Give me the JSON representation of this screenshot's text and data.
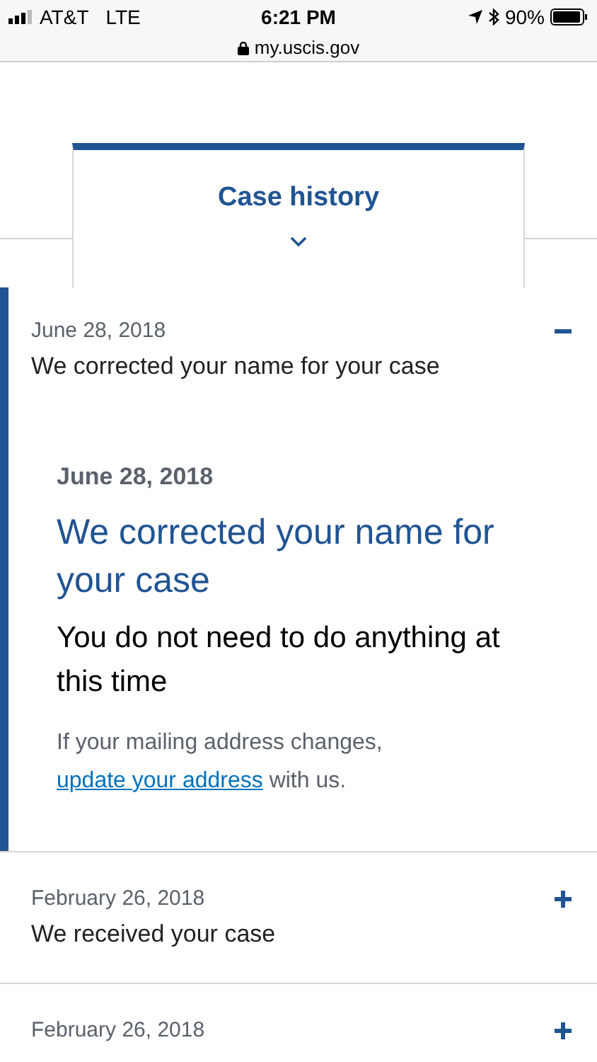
{
  "status_bar": {
    "carrier": "AT&T",
    "network": "LTE",
    "time": "6:21 PM",
    "battery": "90%",
    "url": "my.uscis.gov"
  },
  "tab": {
    "label": "Case history"
  },
  "history": [
    {
      "date": "June 28, 2018",
      "title": "We corrected your name for your case",
      "expanded": true,
      "detail": {
        "date": "June 28, 2018",
        "heading": "We corrected your name for your case",
        "subheading": "You do not need to do anything at this time",
        "text_before": "If your mailing address changes, ",
        "link": "update your address",
        "text_after": " with us."
      }
    },
    {
      "date": "February 26, 2018",
      "title": "We received your case",
      "expanded": false
    },
    {
      "date": "February 26, 2018",
      "expanded": false
    }
  ]
}
